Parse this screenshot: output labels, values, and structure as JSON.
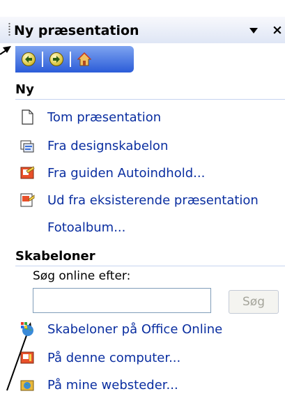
{
  "pane": {
    "title": "Ny præsentation"
  },
  "toolbar": {
    "back_icon": "back-arrow-icon",
    "forward_icon": "forward-arrow-icon",
    "home_icon": "home-icon"
  },
  "section_new": {
    "title": "Ny",
    "items": [
      {
        "label": "Tom præsentation",
        "icon": "blank-document-icon"
      },
      {
        "label": "Fra designskabelon",
        "icon": "design-template-icon"
      },
      {
        "label": "Fra guiden Autoindhold...",
        "icon": "wizard-icon"
      },
      {
        "label": "Ud fra eksisterende præsentation",
        "icon": "existing-presentation-icon"
      },
      {
        "label": "Fotoalbum...",
        "icon": ""
      }
    ]
  },
  "section_templates": {
    "title": "Skabeloner",
    "search_label": "Søg online efter:",
    "search_value": "",
    "search_button": "Søg",
    "items": [
      {
        "label": "Skabeloner på Office Online",
        "icon": "office-online-globe-icon"
      },
      {
        "label": "På denne computer...",
        "icon": "computer-templates-icon"
      },
      {
        "label": "På mine websteder...",
        "icon": "website-icon"
      }
    ]
  }
}
